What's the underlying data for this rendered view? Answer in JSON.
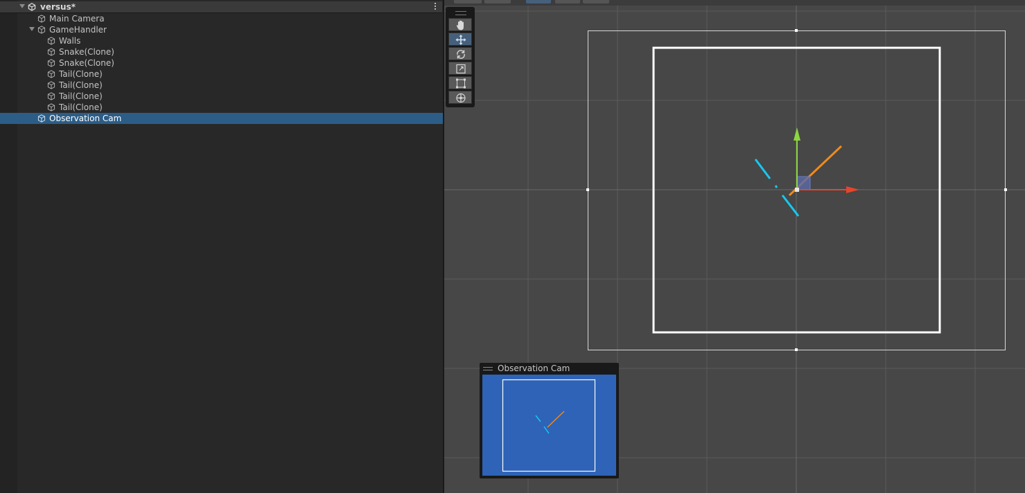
{
  "hierarchy": {
    "scene_name": "versus*",
    "items": [
      {
        "label": "Main Camera"
      },
      {
        "label": "GameHandler"
      },
      {
        "label": "Walls"
      },
      {
        "label": "Snake(Clone)"
      },
      {
        "label": "Snake(Clone)"
      },
      {
        "label": "Tail(Clone)"
      },
      {
        "label": "Tail(Clone)"
      },
      {
        "label": "Tail(Clone)"
      },
      {
        "label": "Tail(Clone)"
      },
      {
        "label": "Observation Cam",
        "selected": true
      }
    ]
  },
  "scene_view": {
    "tools": [
      "hand-tool-icon",
      "move-tool-icon",
      "rotate-tool-icon",
      "scale-tool-icon",
      "rect-tool-icon",
      "transform-tool-icon"
    ],
    "active_tool": "move-tool-icon",
    "colors": {
      "background": "#474747",
      "snake_orange": "#f08a1c",
      "snake_cyan": "#18c8f0",
      "gizmo_x": "#e8442c",
      "gizmo_y": "#8cd640"
    }
  },
  "camera_preview": {
    "title": "Observation Cam",
    "background": "#2e63b7"
  }
}
